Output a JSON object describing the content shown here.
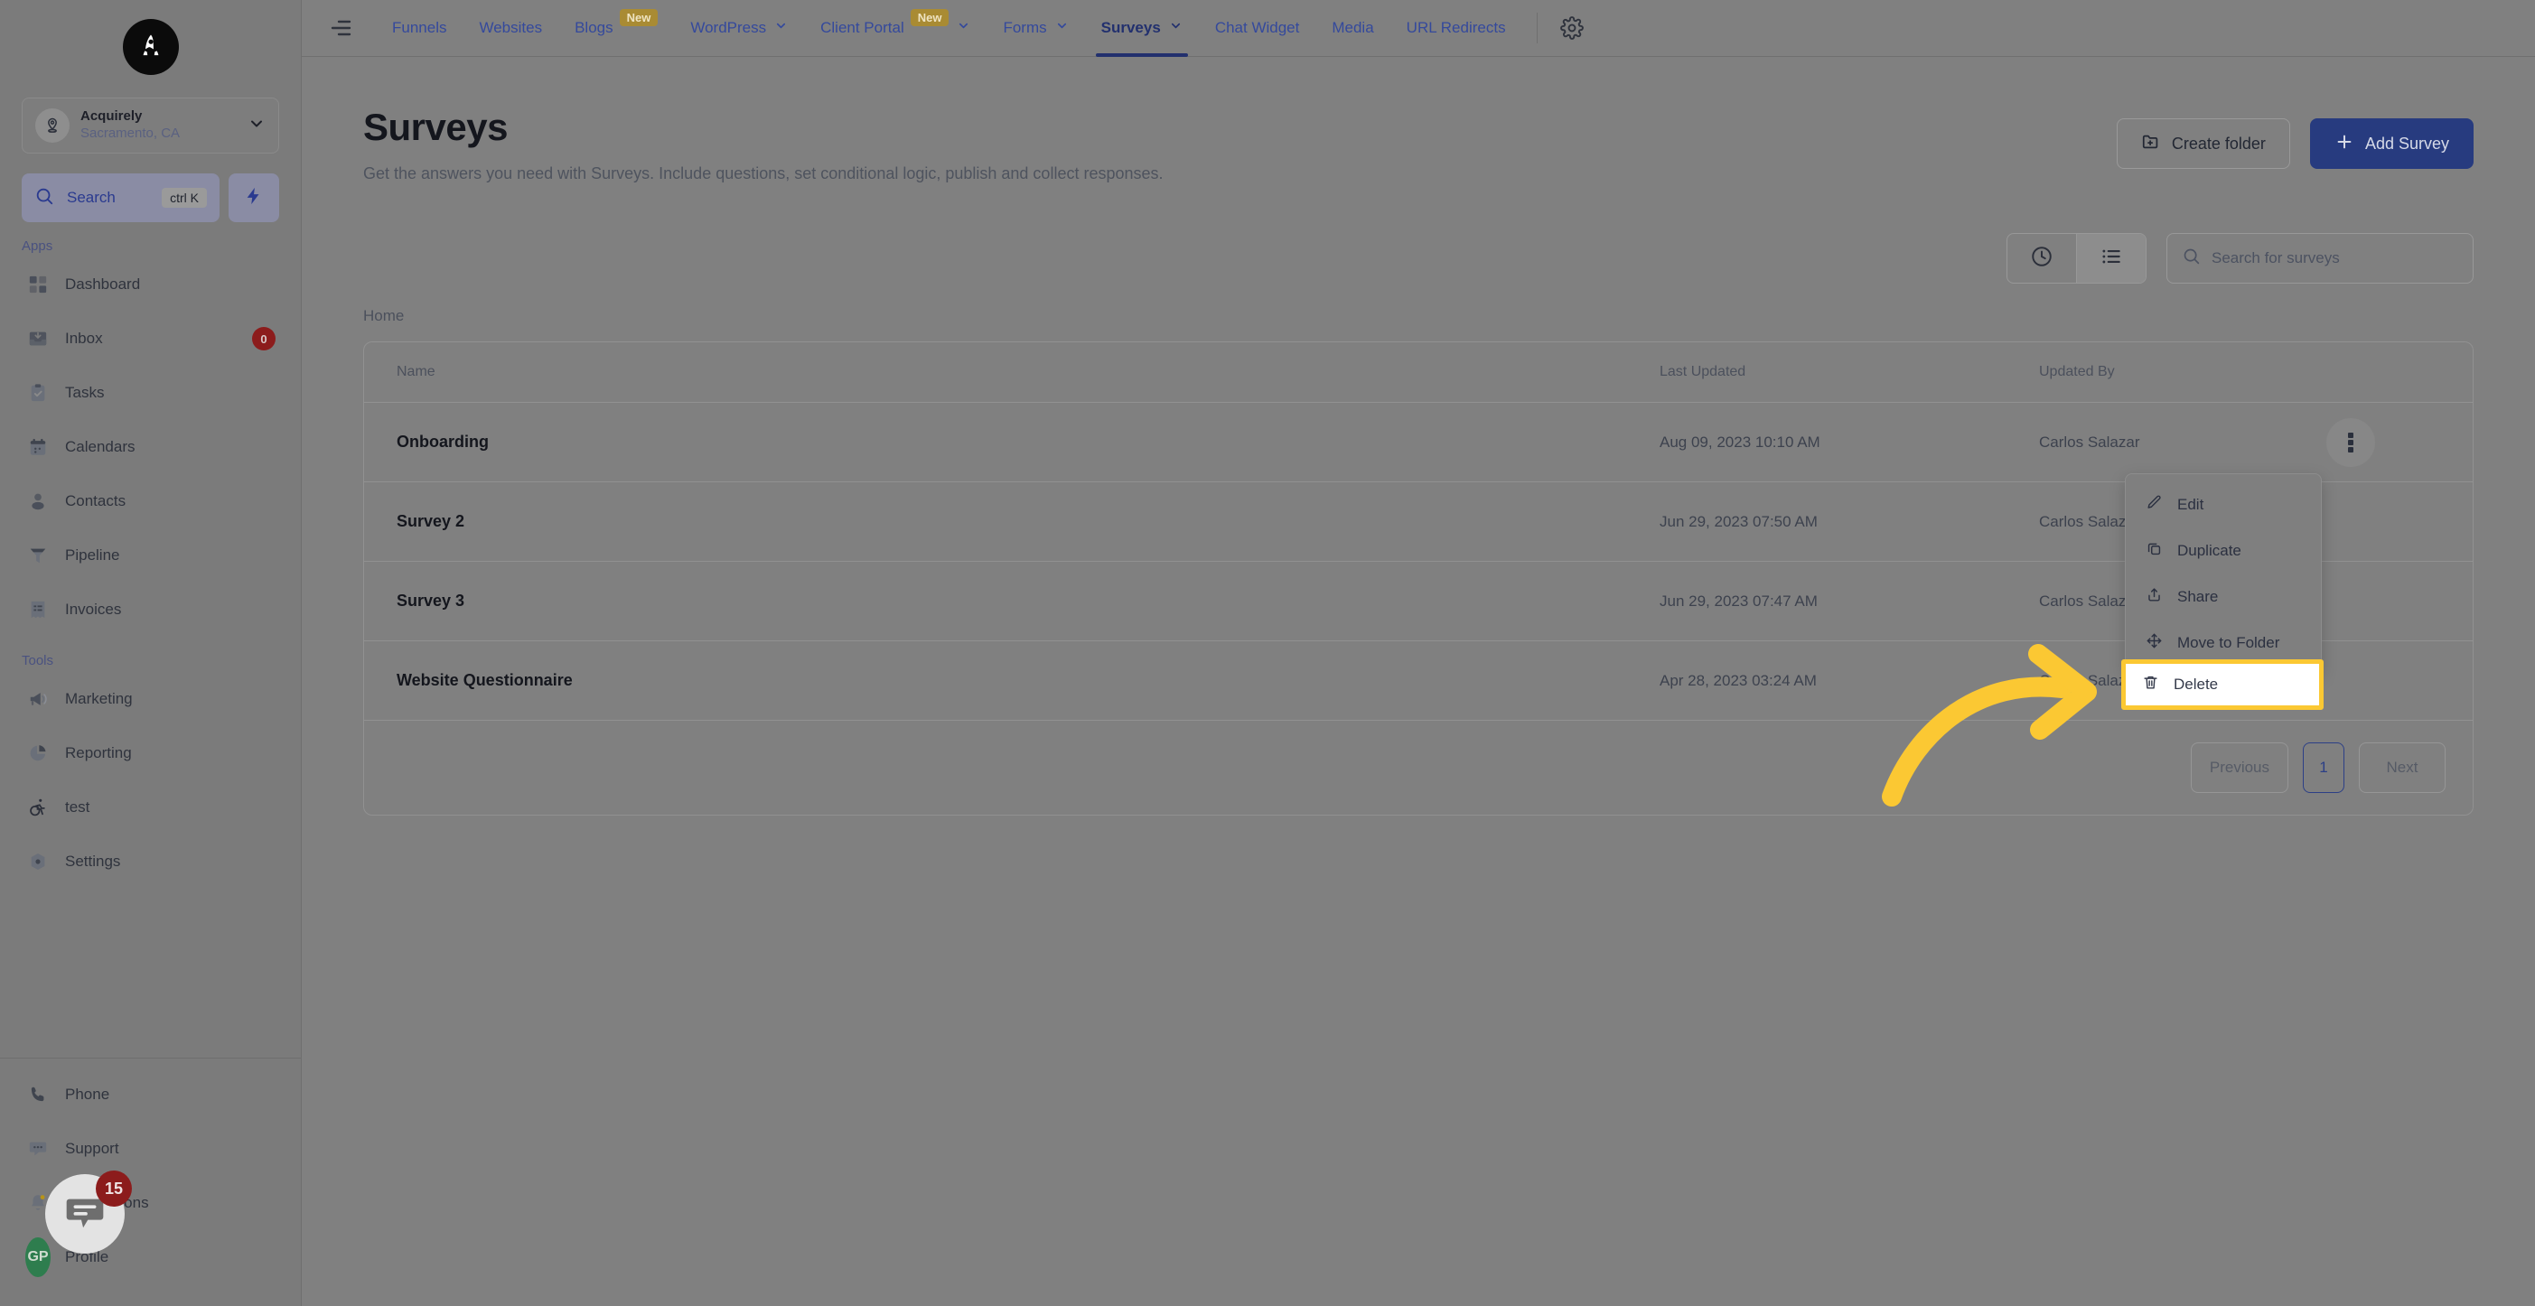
{
  "sidebar": {
    "logo_icon": "rocket-logo-icon",
    "location": {
      "name": "Acquirely",
      "sub": "Sacramento, CA",
      "avatar_icon": "location-pin-icon",
      "chevron_icon": "chevron-down-icon"
    },
    "search": {
      "label": "Search",
      "shortcut": "ctrl K",
      "icon": "search-icon"
    },
    "quick_action_icon": "bolt-icon",
    "apps_label": "Apps",
    "apps": [
      {
        "label": "Dashboard",
        "icon": "dashboard-icon",
        "badge": ""
      },
      {
        "label": "Inbox",
        "icon": "inbox-icon",
        "badge": "0"
      },
      {
        "label": "Tasks",
        "icon": "tasks-icon",
        "badge": ""
      },
      {
        "label": "Calendars",
        "icon": "calendar-icon",
        "badge": ""
      },
      {
        "label": "Contacts",
        "icon": "contacts-icon",
        "badge": ""
      },
      {
        "label": "Pipeline",
        "icon": "pipeline-icon",
        "badge": ""
      },
      {
        "label": "Invoices",
        "icon": "invoices-icon",
        "badge": ""
      }
    ],
    "tools_label": "Tools",
    "tools": [
      {
        "label": "Marketing",
        "icon": "megaphone-icon"
      },
      {
        "label": "Reporting",
        "icon": "pie-chart-icon"
      },
      {
        "label": "test",
        "icon": "accessibility-icon"
      },
      {
        "label": "Settings",
        "icon": "settings-icon"
      }
    ],
    "footer": [
      {
        "label": "Phone",
        "icon": "phone-icon",
        "badge": ""
      },
      {
        "label": "Support",
        "icon": "chat-dots-icon",
        "badge": ""
      },
      {
        "label": "Notifications",
        "icon": "bell-icon",
        "badge": ""
      },
      {
        "label": "Profile",
        "icon": "avatar-icon",
        "badge": ""
      }
    ],
    "profile_initials": "GP",
    "chat_widget": {
      "icon": "chat-bubble-icon",
      "badge": "15"
    }
  },
  "topnav": {
    "collapse_icon": "collapse-menu-icon",
    "settings_icon": "gear-icon",
    "tabs": [
      {
        "label": "Funnels",
        "badge": "",
        "caret": false,
        "active": false
      },
      {
        "label": "Websites",
        "badge": "",
        "caret": false,
        "active": false
      },
      {
        "label": "Blogs",
        "badge": "New",
        "caret": false,
        "active": false
      },
      {
        "label": "WordPress",
        "badge": "",
        "caret": true,
        "active": false
      },
      {
        "label": "Client Portal",
        "badge": "New",
        "caret": true,
        "active": false
      },
      {
        "label": "Forms",
        "badge": "",
        "caret": true,
        "active": false
      },
      {
        "label": "Surveys",
        "badge": "",
        "caret": true,
        "active": true
      },
      {
        "label": "Chat Widget",
        "badge": "",
        "caret": false,
        "active": false
      },
      {
        "label": "Media",
        "badge": "",
        "caret": false,
        "active": false
      },
      {
        "label": "URL Redirects",
        "badge": "",
        "caret": false,
        "active": false
      }
    ]
  },
  "page": {
    "title": "Surveys",
    "subtitle": "Get the answers you need with Surveys. Include questions, set conditional logic, publish and collect responses.",
    "create_folder_label": "Create folder",
    "create_folder_icon": "folder-plus-icon",
    "add_survey_label": "Add Survey",
    "add_survey_icon": "plus-icon",
    "breadcrumb": "Home"
  },
  "toolbar": {
    "history_icon": "clock-icon",
    "list_icon": "list-view-icon",
    "search_placeholder": "Search for surveys",
    "search_value": "",
    "search_icon": "search-icon"
  },
  "table": {
    "columns": [
      "Name",
      "Last Updated",
      "Updated By"
    ],
    "rows": [
      {
        "name": "Onboarding",
        "last_updated": "Aug 09, 2023 10:10 AM",
        "updated_by": "Carlos Salazar"
      },
      {
        "name": "Survey 2",
        "last_updated": "Jun 29, 2023 07:50 AM",
        "updated_by": "Carlos Salazar"
      },
      {
        "name": "Survey 3",
        "last_updated": "Jun 29, 2023 07:47 AM",
        "updated_by": "Carlos Salazar"
      },
      {
        "name": "Website Questionnaire",
        "last_updated": "Apr 28, 2023 03:24 AM",
        "updated_by": "Carlos Salazar"
      }
    ]
  },
  "pagination": {
    "previous": "Previous",
    "page": "1",
    "next": "Next"
  },
  "context_menu": {
    "items": [
      {
        "label": "Edit",
        "icon": "pencil-icon"
      },
      {
        "label": "Duplicate",
        "icon": "copy-icon"
      },
      {
        "label": "Share",
        "icon": "share-upload-icon"
      },
      {
        "label": "Move to Folder",
        "icon": "move-arrows-icon"
      }
    ],
    "highlighted": {
      "label": "Delete",
      "icon": "trash-icon"
    }
  },
  "annotation": {
    "arrow_color": "#fbc833",
    "highlight_color": "#fbc833"
  }
}
